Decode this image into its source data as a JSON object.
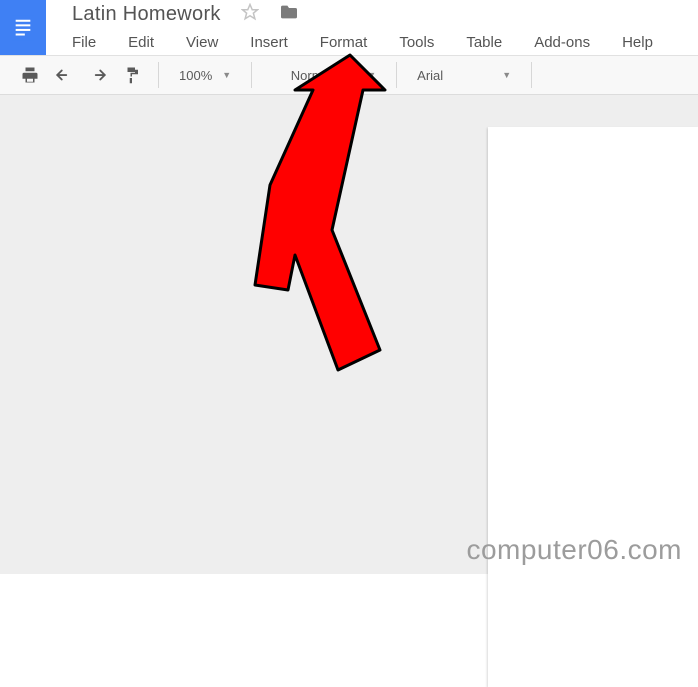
{
  "header": {
    "doc_title": "Latin Homework",
    "menus": {
      "file": "File",
      "edit": "Edit",
      "view": "View",
      "insert": "Insert",
      "format": "Format",
      "tools": "Tools",
      "table": "Table",
      "addons": "Add-ons",
      "help": "Help"
    }
  },
  "toolbar": {
    "zoom": "100%",
    "paragraph_style": "Normal text",
    "font": "Arial"
  },
  "watermark": "computer06.com"
}
